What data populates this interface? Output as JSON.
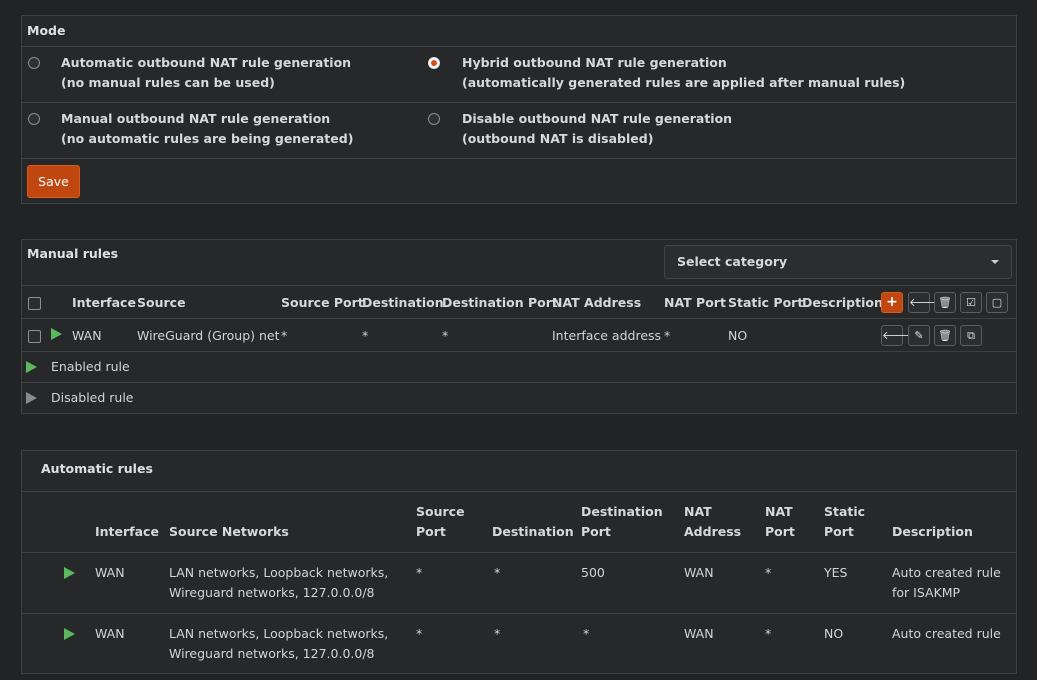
{
  "mode": {
    "title": "Mode",
    "options": [
      {
        "label": "Automatic outbound NAT rule generation",
        "sub": "(no manual rules can be used)",
        "selected": false
      },
      {
        "label": "Hybrid outbound NAT rule generation",
        "sub": "(automatically generated rules are applied after manual rules)",
        "selected": true
      },
      {
        "label": "Manual outbound NAT rule generation",
        "sub": "(no automatic rules are being generated)",
        "selected": false
      },
      {
        "label": "Disable outbound NAT rule generation",
        "sub": "(outbound NAT is disabled)",
        "selected": false
      }
    ],
    "save_label": "Save"
  },
  "manual": {
    "title": "Manual rules",
    "category_placeholder": "Select category",
    "columns": [
      "Interface",
      "Source",
      "Source Port",
      "Destination",
      "Destination Port",
      "NAT Address",
      "NAT Port",
      "Static Port",
      "Description"
    ],
    "rows": [
      {
        "interface": "WAN",
        "source": "WireGuard (Group) net",
        "source_port": "*",
        "destination": "*",
        "destination_port": "*",
        "nat_address": "Interface address",
        "nat_port": "*",
        "static_port": "NO",
        "description": ""
      }
    ],
    "legend_enabled": "Enabled rule",
    "legend_disabled": "Disabled rule",
    "icons": {
      "add": "+",
      "left": "🡐",
      "trash": "🗑",
      "check": "☑",
      "square": "▢",
      "edit": "✎",
      "copy": "⧉"
    }
  },
  "automatic": {
    "title": "Automatic rules",
    "columns": [
      {
        "l1": "",
        "l2": "Interface"
      },
      {
        "l1": "",
        "l2": "Source Networks"
      },
      {
        "l1": "Source",
        "l2": "Port"
      },
      {
        "l1": "",
        "l2": "Destination"
      },
      {
        "l1": "Destination",
        "l2": "Port"
      },
      {
        "l1": "NAT",
        "l2": "Address"
      },
      {
        "l1": "NAT",
        "l2": "Port"
      },
      {
        "l1": "Static",
        "l2": "Port"
      },
      {
        "l1": "",
        "l2": "Description"
      }
    ],
    "rows": [
      {
        "interface": "WAN",
        "src1": "LAN networks, Loopback networks,",
        "src2": "Wireguard networks, 127.0.0.0/8",
        "source_port": "*",
        "destination": "*",
        "destination_port": "500",
        "nat_address": "WAN",
        "nat_port": "*",
        "static_port": "YES",
        "desc1": "Auto created rule",
        "desc2": "for ISAKMP"
      },
      {
        "interface": "WAN",
        "src1": "LAN networks, Loopback networks,",
        "src2": "Wireguard networks, 127.0.0.0/8",
        "source_port": "*",
        "destination": "*",
        "destination_port": "*",
        "nat_address": "WAN",
        "nat_port": "*",
        "static_port": "NO",
        "desc1": "Auto created rule",
        "desc2": ""
      }
    ]
  }
}
